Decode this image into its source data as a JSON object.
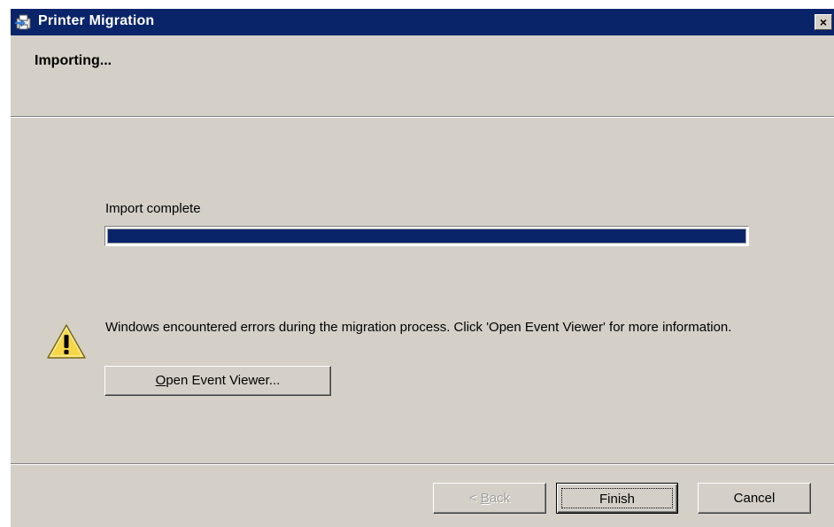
{
  "window": {
    "title": "Printer Migration",
    "close_label": "×",
    "title_icon": "printer-migration-icon"
  },
  "header": {
    "title": "Importing..."
  },
  "progress": {
    "label": "Import complete",
    "value_percent": 100,
    "fill_color": "#0a246a"
  },
  "message": {
    "icon": "warning-icon",
    "text": "Windows encountered errors during the migration process.  Click 'Open Event Viewer' for more information.",
    "open_event_viewer": {
      "prefix": "",
      "mnemonic": "O",
      "rest": "pen Event Viewer..."
    }
  },
  "footer": {
    "back": {
      "prefix": "< ",
      "mnemonic": "B",
      "rest": "ack",
      "enabled": false
    },
    "finish_label": "Finish",
    "cancel_label": "Cancel"
  }
}
